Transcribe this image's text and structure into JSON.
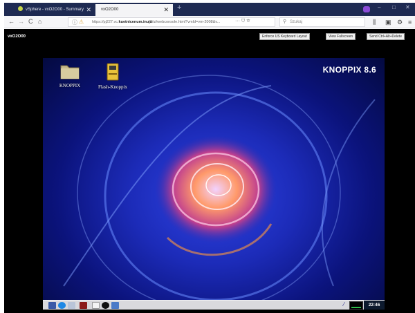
{
  "browser": {
    "tabs": [
      {
        "label": "vSphere - vxO2O00 - Summary"
      },
      {
        "label": "vxO2O00"
      }
    ],
    "new_tab": "+",
    "close_glyph": "✕",
    "nav": {
      "back": "←",
      "forward": "→",
      "reload": "C",
      "home": "⌂"
    },
    "url": {
      "prefix": "https://pj227.vc.",
      "host": "kuetnicenum.inujā",
      "path": "/ui/webconsole.html?vmId=vm-2008&v..."
    },
    "url_icons": "··· ⛉ ☆",
    "search": {
      "placeholder": "Szukaj"
    },
    "toolbar_icons": [
      "library-icon",
      "sidebar-icon",
      "gear-icon",
      "menu-icon"
    ],
    "window_controls": [
      "–",
      "□",
      "✕"
    ],
    "colors": {
      "tabstrip": "#1e2a52",
      "active_tab": "#f4f4f6"
    }
  },
  "console": {
    "vm_name": "vxO2O00",
    "buttons": [
      "Enforce US Keyboard Layout",
      "View Fullscreen",
      "Send Ctrl+Alt+Delete"
    ]
  },
  "desktop": {
    "brand": "KNOPPIX 8.6",
    "icons": [
      {
        "label": "KNOPPIX",
        "type": "folder-icon"
      },
      {
        "label": "Flash-Knoppix",
        "type": "usb-drive-icon"
      }
    ],
    "taskbar": {
      "items": [
        "start-menu-icon",
        "browser-icon",
        "files-icon",
        "terminal-icon",
        "document-icon",
        "app-icon",
        "screen-icon"
      ],
      "clock": "22:46"
    },
    "colors": {
      "bg_primary": "#1c2bb8",
      "swirl": "#ff9a3c",
      "taskbar": "#d9d9dd"
    }
  }
}
